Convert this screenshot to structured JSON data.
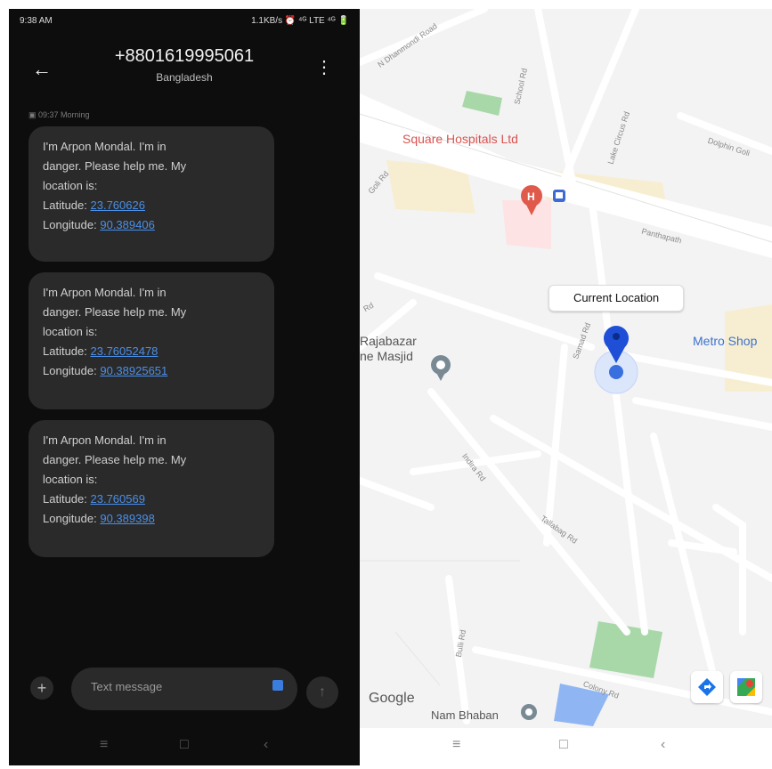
{
  "left": {
    "status": {
      "time": "9:38 AM",
      "right": "1.1KB/s ⏰ ⁴ᴳ LTE ⁴ᴳ 🔋"
    },
    "header": {
      "back": "←",
      "phone": "+8801619995061",
      "country": "Bangladesh",
      "menu": "⋮"
    },
    "timestamp": "09:37 Morning",
    "messages": [
      {
        "line1": "I'm Arpon Mondal. I'm in",
        "line2": "danger. Please help me. My",
        "line3": "location is:",
        "lat_label": "Latitude:",
        "lat": "23.760626",
        "lon_label": "Longitude:",
        "lon": "90.389406"
      },
      {
        "line1": "I'm Arpon Mondal. I'm in",
        "line2": "danger. Please help me. My",
        "line3": "location is:",
        "lat_label": "Latitude:",
        "lat": "23.76052478",
        "lon_label": "Longitude:",
        "lon": "90.38925651"
      },
      {
        "line1": "I'm Arpon Mondal. I'm in",
        "line2": "danger. Please help me. My",
        "line3": "location is:",
        "lat_label": "Latitude:",
        "lat": "23.760569",
        "lon_label": "Longitude:",
        "lon": "90.389398"
      }
    ],
    "compose": {
      "placeholder": "Text message",
      "plus": "+",
      "send": "↑"
    },
    "nav": {
      "recents": "≡",
      "home": "□",
      "back": "‹"
    }
  },
  "map": {
    "callout": "Current Location",
    "places": {
      "hospital": "Square Hospitals Ltd",
      "masjid_line1": "Rajabazar",
      "masjid_line2": "ne Masjid",
      "shop": "Metro Shop",
      "bhaban": "Nam Bhaban"
    },
    "roads": {
      "panthapath": "Panthapath",
      "dolphin": "Dolphin Goli",
      "green_rd": "Green Rd",
      "lake_circus": "Lake Circus Rd",
      "school_rd": "School Rd",
      "dhanmondi": "N Dhanmondi Road",
      "indira": "Indira Rd",
      "tallabag": "Tallabag Rd",
      "samad": "Samad Rd",
      "bulli": "Bulli Rd",
      "colony": "Colony Rd",
      "rd": "Rd",
      "goli": "Goli Rd"
    },
    "google": "Google",
    "nav": {
      "recents": "≡",
      "home": "□",
      "back": "‹"
    },
    "colors": {
      "marker": "#1e4fd6",
      "hospital": "#e05a4b",
      "road_label": "#8a8a8a"
    }
  }
}
